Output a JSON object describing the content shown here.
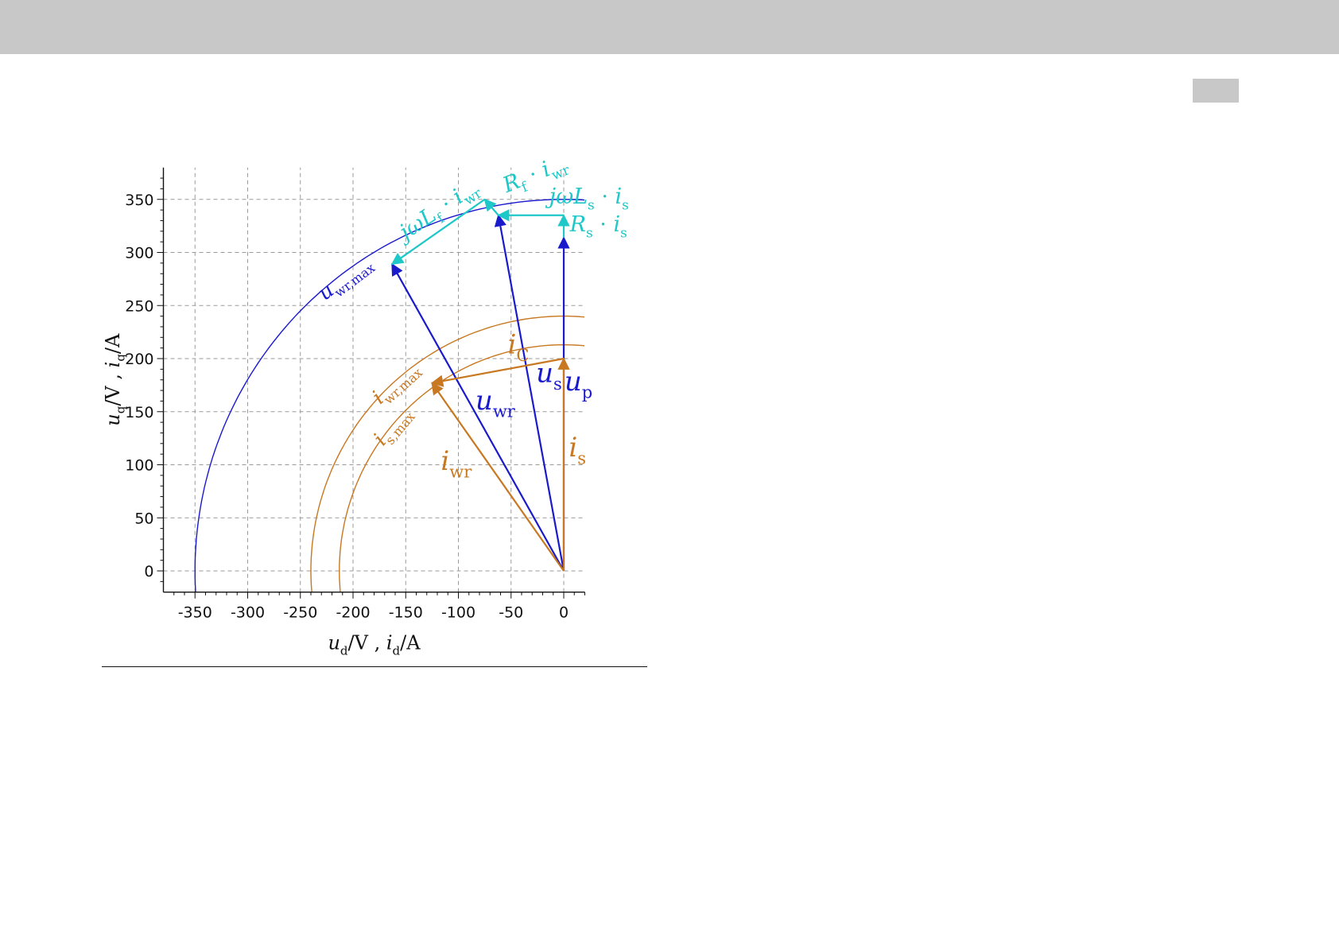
{
  "chart_data": {
    "type": "line",
    "xlim": [
      -380,
      20
    ],
    "ylim": [
      -20,
      380
    ],
    "xticks": [
      -350,
      -300,
      -250,
      -200,
      -150,
      -100,
      -50,
      0
    ],
    "yticks": [
      0,
      50,
      100,
      150,
      200,
      250,
      300,
      350
    ],
    "xtick_labels": [
      "-350",
      "-300",
      "-250",
      "-200",
      "-150",
      "-100",
      "-50",
      "0"
    ],
    "ytick_labels": [
      "0",
      "50",
      "100",
      "150",
      "200",
      "250",
      "300",
      "350"
    ],
    "xlabel": {
      "main": "u",
      "sub": "d",
      "rest": "/V  ,  ",
      "main2": "i",
      "sub2": "d",
      "rest2": "/A"
    },
    "ylabel": {
      "main": "u",
      "sub": "q",
      "rest": "/V  ,  ",
      "main2": "i",
      "sub2": "q",
      "rest2": "/A"
    },
    "grid": true,
    "colors": {
      "voltage": "#1a1acd",
      "current": "#c87820",
      "drop": "#1ec8c8",
      "circle_voltage": "#1a1acd",
      "circle_current": "#c87820"
    },
    "circles": [
      {
        "name_main": "u",
        "name_sub": "wr,max",
        "radius": 350,
        "color": "#1a1acd"
      },
      {
        "name_main": "i",
        "name_sub": "wr,max",
        "radius": 240,
        "color": "#c87820"
      },
      {
        "name_main": "i",
        "name_sub": "s,max",
        "radius": 213,
        "color": "#c87820"
      }
    ],
    "vectors": [
      {
        "name_main": "u",
        "name_sub": "p",
        "from": [
          0,
          0
        ],
        "to": [
          0,
          314
        ],
        "color": "#1a1acd"
      },
      {
        "name_main": "u",
        "name_sub": "s",
        "from": [
          0,
          0
        ],
        "to": [
          -62,
          335
        ],
        "color": "#1a1acd"
      },
      {
        "name_main": "u",
        "name_sub": "wr",
        "from": [
          0,
          0
        ],
        "to": [
          -163,
          289
        ],
        "color": "#1a1acd"
      },
      {
        "name_main": "i",
        "name_sub": "s",
        "from": [
          0,
          0
        ],
        "to": [
          0,
          200
        ],
        "color": "#c87820"
      },
      {
        "name_main": "i",
        "name_sub": "wr",
        "from": [
          0,
          0
        ],
        "to": [
          -125,
          177
        ],
        "color": "#c87820"
      },
      {
        "name_main": "i",
        "name_sub": "C",
        "from": [
          0,
          200
        ],
        "to": [
          -125,
          177
        ],
        "color": "#c87820"
      },
      {
        "name_main": "R",
        "name_sub": "s",
        "suffix_main": "i",
        "suffix_sub": "s",
        "from": [
          0,
          314
        ],
        "to": [
          0,
          335
        ],
        "color": "#1ec8c8"
      },
      {
        "name_main": "jωL",
        "name_sub": "s",
        "suffix_main": "i",
        "suffix_sub": "s",
        "from": [
          0,
          335
        ],
        "to": [
          -62,
          335
        ],
        "color": "#1ec8c8"
      },
      {
        "name_main": "R",
        "name_sub": "f",
        "suffix_main": "i",
        "suffix_sub": "wr",
        "from": [
          -62,
          335
        ],
        "to": [
          -75,
          350
        ],
        "color": "#1ec8c8"
      },
      {
        "name_main": "jωL",
        "name_sub": "f",
        "suffix_main": "i",
        "suffix_sub": "wr",
        "from": [
          -75,
          350
        ],
        "to": [
          -163,
          289
        ],
        "color": "#1ec8c8"
      }
    ]
  }
}
